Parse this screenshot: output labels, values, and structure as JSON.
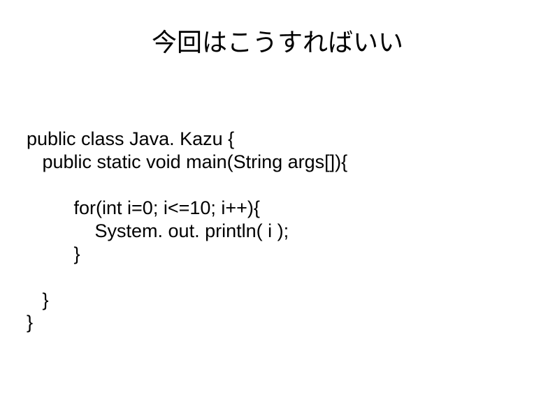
{
  "title": "今回はこうすればいい",
  "code": {
    "l1": "public class Java. Kazu {",
    "l2": "   public static void main(String args[]){",
    "l3": "",
    "l4": "         for(int i=0; i<=10; i++){",
    "l5": "             System. out. println( i );",
    "l6": "         }",
    "l7": "",
    "l8": "   }",
    "l9": "}"
  }
}
